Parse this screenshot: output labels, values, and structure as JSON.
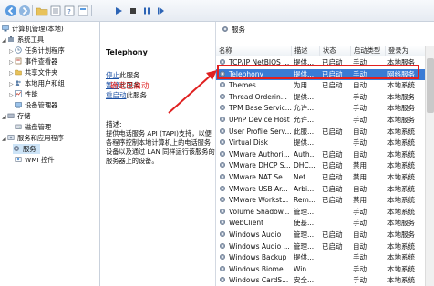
{
  "toolbar": {
    "buttons": [
      "back-icon",
      "forward-icon",
      "folder-icon",
      "list-icon",
      "help-icon",
      "properties-icon",
      "play-icon",
      "stop-icon",
      "pause-icon",
      "restart-icon"
    ]
  },
  "tree": {
    "items": [
      {
        "label": "计算机管理(本地)",
        "icon": "computer-icon"
      },
      {
        "label": "系统工具",
        "icon": "tools-icon"
      },
      {
        "label": "任务计划程序",
        "icon": "clock-icon"
      },
      {
        "label": "事件查看器",
        "icon": "event-icon"
      },
      {
        "label": "共享文件夹",
        "icon": "folder-icon"
      },
      {
        "label": "本地用户和组",
        "icon": "users-icon"
      },
      {
        "label": "性能",
        "icon": "performance-icon"
      },
      {
        "label": "设备管理器",
        "icon": "device-icon"
      },
      {
        "label": "存储",
        "icon": "storage-icon"
      },
      {
        "label": "磁盘管理",
        "icon": "disk-icon"
      },
      {
        "label": "服务和应用程序",
        "icon": "services-app-icon"
      },
      {
        "label": "服务",
        "icon": "gear-icon"
      },
      {
        "label": "WMI 控件",
        "icon": "wmi-icon"
      }
    ]
  },
  "header_label": "服务",
  "description": {
    "title": "Telephony",
    "stop_link": "停止",
    "stop_suffix": "此服务",
    "pause_link": "暂停",
    "pause_suffix": "此服务",
    "restart_link": "重启动",
    "restart_suffix": "此服务",
    "label": "描述:",
    "text": "提供电话服务 API (TAPI)支持，以便各程序控制本地计算机上的电话服务设备以及通过 LAN 同样运行该服务的服务器上的设备。"
  },
  "annotation": "确定已启动",
  "columns": [
    "名称",
    "描述",
    "状态",
    "启动类型",
    "登录为"
  ],
  "services": [
    {
      "name": "TCP/IP NetBIOS ...",
      "desc": "提供...",
      "status": "已启动",
      "start": "手动",
      "logon": "本地服务"
    },
    {
      "name": "Telephony",
      "desc": "提供...",
      "status": "已启动",
      "start": "手动",
      "logon": "网络服务",
      "selected": true
    },
    {
      "name": "Themes",
      "desc": "为用...",
      "status": "已启动",
      "start": "自动",
      "logon": "本地系统"
    },
    {
      "name": "Thread Orderin...",
      "desc": "提供...",
      "status": "",
      "start": "手动",
      "logon": "本地服务"
    },
    {
      "name": "TPM Base Servic...",
      "desc": "允许...",
      "status": "",
      "start": "手动",
      "logon": "本地服务"
    },
    {
      "name": "UPnP Device Host",
      "desc": "允许...",
      "status": "",
      "start": "手动",
      "logon": "本地服务"
    },
    {
      "name": "User Profile Serv...",
      "desc": "此服...",
      "status": "已启动",
      "start": "自动",
      "logon": "本地系统"
    },
    {
      "name": "Virtual Disk",
      "desc": "提供...",
      "status": "",
      "start": "手动",
      "logon": "本地系统"
    },
    {
      "name": "VMware Authori...",
      "desc": "Auth...",
      "status": "已启动",
      "start": "自动",
      "logon": "本地系统"
    },
    {
      "name": "VMware DHCP S...",
      "desc": "DHC...",
      "status": "已启动",
      "start": "禁用",
      "logon": "本地系统"
    },
    {
      "name": "VMware NAT Se...",
      "desc": "Net...",
      "status": "已启动",
      "start": "禁用",
      "logon": "本地系统"
    },
    {
      "name": "VMware USB Ar...",
      "desc": "Arbi...",
      "status": "已启动",
      "start": "自动",
      "logon": "本地系统"
    },
    {
      "name": "VMware Workst...",
      "desc": "Rem...",
      "status": "已启动",
      "start": "禁用",
      "logon": "本地系统"
    },
    {
      "name": "Volume Shadow...",
      "desc": "管理...",
      "status": "",
      "start": "手动",
      "logon": "本地系统"
    },
    {
      "name": "WebClient",
      "desc": "使基...",
      "status": "",
      "start": "手动",
      "logon": "本地服务"
    },
    {
      "name": "Windows Audio",
      "desc": "管理...",
      "status": "已启动",
      "start": "自动",
      "logon": "本地服务"
    },
    {
      "name": "Windows Audio ...",
      "desc": "管理...",
      "status": "已启动",
      "start": "自动",
      "logon": "本地系统"
    },
    {
      "name": "Windows Backup",
      "desc": "提供...",
      "status": "",
      "start": "手动",
      "logon": "本地系统"
    },
    {
      "name": "Windows Biome...",
      "desc": "Win...",
      "status": "",
      "start": "手动",
      "logon": "本地系统"
    },
    {
      "name": "Windows CardS...",
      "desc": "安全...",
      "status": "",
      "start": "手动",
      "logon": "本地系统"
    }
  ],
  "colors": {
    "selection": "#3a7bd5",
    "annotation": "#e02020",
    "link": "#1a4fa3"
  }
}
